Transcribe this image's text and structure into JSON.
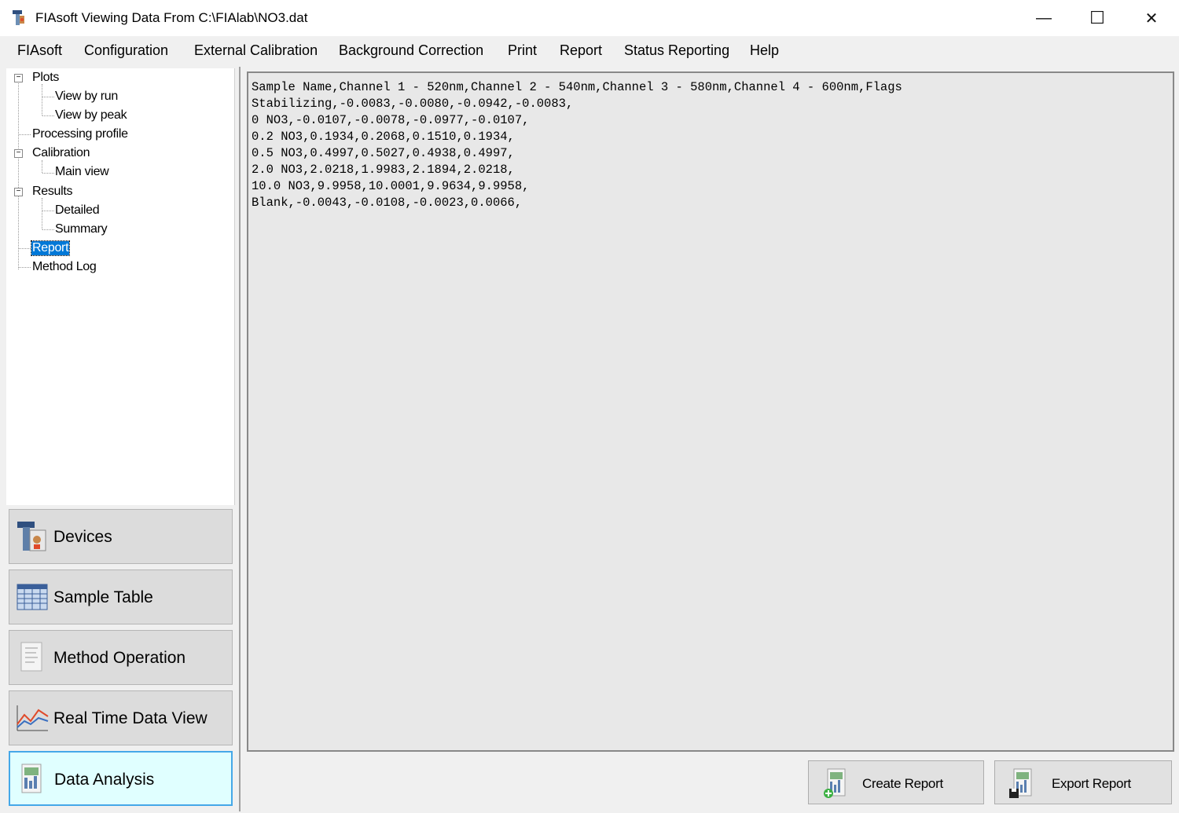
{
  "window": {
    "title": "FIAsoft Viewing Data From C:\\FIAlab\\NO3.dat",
    "minimize_glyph": "—",
    "maximize_glyph": "☐",
    "close_glyph": "✕"
  },
  "menu": [
    "FIAsoft",
    "Configuration",
    "External Calibration",
    "Background Correction",
    "Print",
    "Report",
    "Status Reporting",
    "Help"
  ],
  "tree": {
    "plots": "Plots",
    "view_by_run": "View by run",
    "view_by_peak": "View by peak",
    "processing_profile": "Processing profile",
    "calibration": "Calibration",
    "main_view": "Main view",
    "results": "Results",
    "detailed": "Detailed",
    "summary": "Summary",
    "report": "Report",
    "method_log": "Method Log",
    "expander_glyph": "−"
  },
  "nav": {
    "devices": "Devices",
    "sample_table": "Sample Table",
    "method_operation": "Method Operation",
    "real_time_data_view": "Real Time Data View",
    "data_analysis": "Data Analysis",
    "active_color": "#e0ffff"
  },
  "report_lines": [
    "Sample Name,Channel 1 - 520nm,Channel 2 - 540nm,Channel 3 - 580nm,Channel 4 - 600nm,Flags",
    "Stabilizing,-0.0083,-0.0080,-0.0942,-0.0083,",
    "0 NO3,-0.0107,-0.0078,-0.0977,-0.0107,",
    "0.2 NO3,0.1934,0.2068,0.1510,0.1934,",
    "0.5 NO3,0.4997,0.5027,0.4938,0.4997,",
    "2.0 NO3,2.0218,1.9983,2.1894,2.0218,",
    "10.0 NO3,9.9958,10.0001,9.9634,9.9958,",
    "Blank,-0.0043,-0.0108,-0.0023,0.0066,"
  ],
  "actions": {
    "create_report": "Create Report",
    "export_report": "Export Report"
  },
  "colors": {
    "selection": "#0078d7",
    "active_border": "#45a8e8"
  }
}
